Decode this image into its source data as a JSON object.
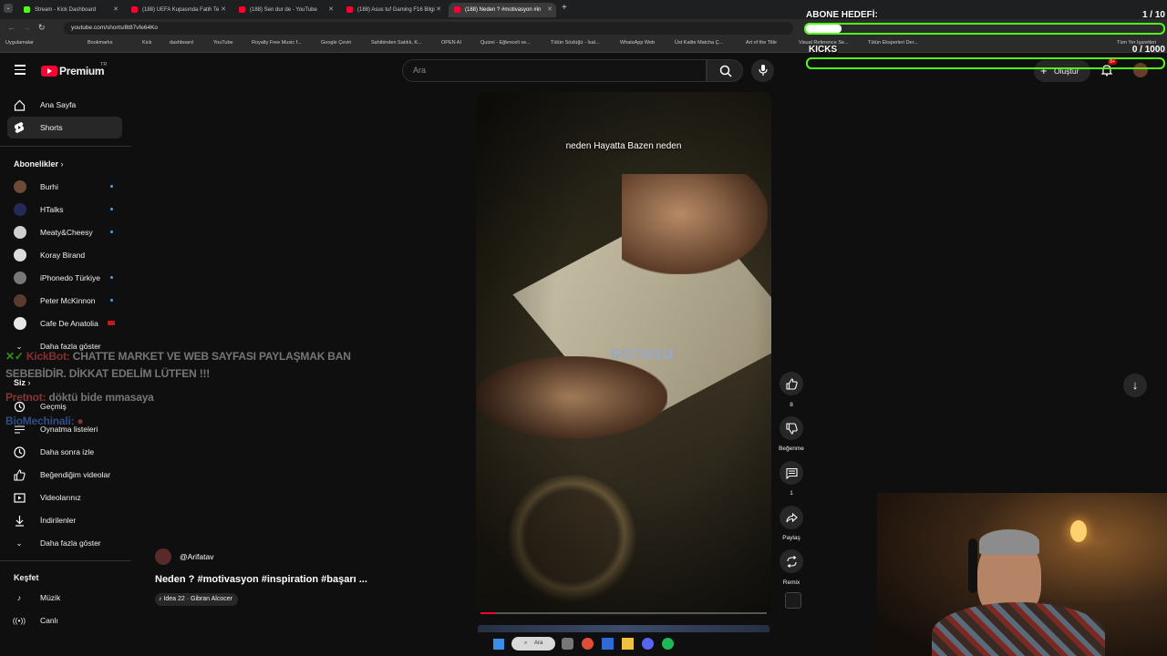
{
  "browser": {
    "tabs": [
      {
        "title": "Stream - Kick Dashboard",
        "color": "#53fc18"
      },
      {
        "title": "(188) UEFA Kupasında Fatih Te",
        "color": "#ff0033"
      },
      {
        "title": "(188) Sen dur de - YouTube",
        "color": "#ff0033"
      },
      {
        "title": "(188) Asus tuf Gaming F16 Bilgi",
        "color": "#ff0033"
      },
      {
        "title": "(188) Neden ? #motivasyon #in",
        "color": "#ff0033"
      }
    ],
    "url": "youtube.com/shorts/8t87vfe64Ko",
    "bookmarks": [
      "Uygulamalar",
      "Bookmarks",
      "Kick",
      "dashboard",
      "YouTube",
      "Royalty Free Music f...",
      "Google Çeviri",
      "Sahibinden Satılık, K...",
      "OPEN AI",
      "Quizei - Eğlenceli ve...",
      "Tütün Sözlüğü - İsal...",
      "WhatsApp Web",
      "Üst Kalite Matcha Ç...",
      "Art of the Title",
      "Visual Reference Se...",
      "Tütün Eksperleri Der...",
      "Tüm Yer İşaretleri"
    ]
  },
  "header": {
    "logo_text": "Premium",
    "logo_region": "TR",
    "search_placeholder": "Ara",
    "create_label": "Oluştur",
    "notif_count": "9+"
  },
  "sidebar": {
    "main": [
      {
        "label": "Ana Sayfa",
        "icon": "home-icon"
      },
      {
        "label": "Shorts",
        "icon": "shorts-icon"
      }
    ],
    "subs_title": "Abonelikler",
    "subs": [
      {
        "label": "Burhi",
        "color": "#6b4a36"
      },
      {
        "label": "HTalks",
        "color": "#222a55"
      },
      {
        "label": "Meaty&Cheesy",
        "color": "#cfcfcf"
      },
      {
        "label": "Koray Birand",
        "color": "#dddddd"
      },
      {
        "label": "iPhonedo Türkiye",
        "color": "#777777"
      },
      {
        "label": "Peter McKinnon",
        "color": "#5a3b2e"
      },
      {
        "label": "Cafe De Anatolia",
        "color": "#e8e8e8"
      }
    ],
    "subs_more": "Daha fazla göster",
    "you_title": "Siz",
    "you": [
      {
        "label": "Geçmiş",
        "icon": "history-icon"
      },
      {
        "label": "Oynatma listeleri",
        "icon": "playlist-icon"
      },
      {
        "label": "Daha sonra izle",
        "icon": "clock-icon"
      },
      {
        "label": "Beğendiğim videolar",
        "icon": "thumb-up-icon"
      },
      {
        "label": "Videolarınız",
        "icon": "video-icon"
      },
      {
        "label": "İndirilenler",
        "icon": "download-icon"
      },
      {
        "label": "Daha fazla göster",
        "icon": "chevron-down-icon"
      }
    ],
    "explore_title": "Keşfet",
    "explore": [
      {
        "label": "Müzik",
        "icon": "music-icon"
      },
      {
        "label": "Canlı",
        "icon": "live-icon"
      }
    ]
  },
  "video": {
    "caption_top": "neden Hayatta Bazen neden",
    "caption_mid": "sorusu",
    "channel": "@Arifatav",
    "title": "Neden ? #motivasyon #inspiration #başarı ...",
    "music": "Idea 22 · Gibran Alcocer",
    "progress": 0.05
  },
  "actions": {
    "likes": "8",
    "dislike": "Beğenme",
    "comments": "1",
    "share": "Paylaş",
    "remix": "Remix"
  },
  "overlay": {
    "goal1_title": "ABONE HEDEFİ:",
    "goal1_value": "1 / 10",
    "goal1_progress": 0.1,
    "goal2_title": "KICKS",
    "goal2_value": "0 / 1000",
    "goal2_progress": 0,
    "chat": [
      {
        "user": "KickBot:",
        "msg": "CHATTE MARKET VE WEB SAYFASI PAYLAŞMAK BAN"
      },
      {
        "user": "",
        "msg": "SEBEBİDİR. DİKKAT EDELİM LÜTFEN !!!"
      },
      {
        "user": "Pretnot:",
        "msg": "döktü bide mmasaya"
      },
      {
        "user": "BioMechinali:",
        "msg": ""
      }
    ]
  },
  "taskbar": {
    "search_label": "Ara"
  },
  "colors": {
    "kick_green": "#53fc18",
    "yt_red": "#ff0033",
    "accent_blue": "#3ea6ff"
  }
}
